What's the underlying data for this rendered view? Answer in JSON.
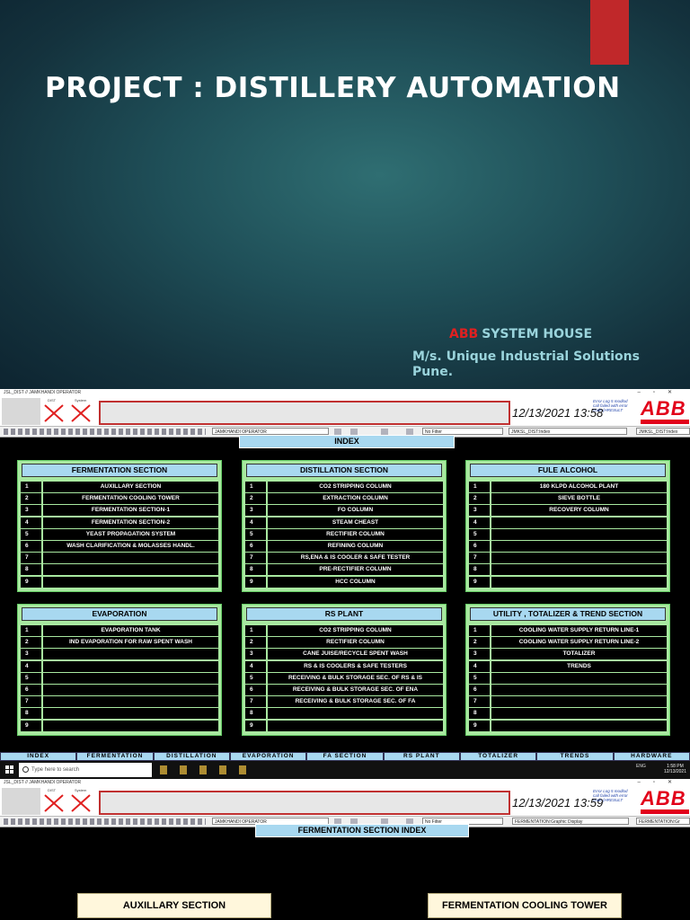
{
  "slide": {
    "title": "PROJECT : DISTILLERY AUTOMATION",
    "brand": "ABB",
    "brand_suffix": "SYSTEM HOUSE",
    "company_line1": "M/s. Unique Industrial Solutions",
    "company_line2": "Pune.",
    "accent_color": "#c0282a"
  },
  "screen1": {
    "window_title": "JSL_DIST // JAMKHANDI OPERATOR",
    "ack_labels": [
      "DIST",
      "System"
    ],
    "datetime": "12/13/2021 13:58",
    "error_log": "Error Log 5 modlod call failed with error code (HRESULT",
    "abb_logo": "ABB",
    "operator_combo": "JAMKHANDI OPERATOR",
    "filter_combo": "No Filter",
    "display_combo": "JMKSL_DIST:Index",
    "display_combo2": "JMKSL_DIST:Index",
    "index_title": "INDEX",
    "panels": [
      {
        "title": "FERMENTATION SECTION",
        "rows": [
          {
            "n": "1",
            "label": "AUXILLARY SECTION"
          },
          {
            "n": "2",
            "label": "FERMENTATION COOLING TOWER"
          },
          {
            "n": "3",
            "label": "FERMENTATION SECTION-1"
          },
          {
            "n": "4",
            "label": "FERMENTATION SECTION-2"
          },
          {
            "n": "5",
            "label": "YEAST PROPAGATION SYSTEM"
          },
          {
            "n": "6",
            "label": "WASH CLARIFICATION & MOLASSES HANDL."
          },
          {
            "n": "7",
            "label": ""
          },
          {
            "n": "8",
            "label": ""
          },
          {
            "n": "9",
            "label": ""
          }
        ]
      },
      {
        "title": "DISTILLATION SECTION",
        "rows": [
          {
            "n": "1",
            "label": "CO2 STRIPPING COLUMN"
          },
          {
            "n": "2",
            "label": "EXTRACTION COLUMN"
          },
          {
            "n": "3",
            "label": "FO COLUMN"
          },
          {
            "n": "4",
            "label": "STEAM CHEAST"
          },
          {
            "n": "5",
            "label": "RECTIFIER COLUMN"
          },
          {
            "n": "6",
            "label": "REFINING COLUMN"
          },
          {
            "n": "7",
            "label": "RS,ENA & IS COOLER & SAFE TESTER"
          },
          {
            "n": "8",
            "label": "PRE-RECTIFIER COLUMN"
          },
          {
            "n": "9",
            "label": "HCC COLUMN"
          }
        ]
      },
      {
        "title": "FULE ALCOHOL",
        "rows": [
          {
            "n": "1",
            "label": "180 KLPD ALCOHOL PLANT"
          },
          {
            "n": "2",
            "label": "SIEVE BOTTLE"
          },
          {
            "n": "3",
            "label": "RECOVERY COLUMN"
          },
          {
            "n": "4",
            "label": ""
          },
          {
            "n": "5",
            "label": ""
          },
          {
            "n": "6",
            "label": ""
          },
          {
            "n": "7",
            "label": ""
          },
          {
            "n": "8",
            "label": ""
          },
          {
            "n": "9",
            "label": ""
          }
        ]
      },
      {
        "title": "EVAPORATION",
        "rows": [
          {
            "n": "1",
            "label": "EVAPORATION TANK"
          },
          {
            "n": "2",
            "label": "IND EVAPORATION FOR RAW SPENT WASH"
          },
          {
            "n": "3",
            "label": ""
          },
          {
            "n": "4",
            "label": ""
          },
          {
            "n": "5",
            "label": ""
          },
          {
            "n": "6",
            "label": ""
          },
          {
            "n": "7",
            "label": ""
          },
          {
            "n": "8",
            "label": ""
          },
          {
            "n": "9",
            "label": ""
          }
        ]
      },
      {
        "title": "RS PLANT",
        "rows": [
          {
            "n": "1",
            "label": "CO2 STRIPPING COLUMN"
          },
          {
            "n": "2",
            "label": "RECTIFIER COLUMN"
          },
          {
            "n": "3",
            "label": "CANE JUISE/RECYCLE SPENT WASH"
          },
          {
            "n": "4",
            "label": "RS & IS COOLERS & SAFE TESTERS"
          },
          {
            "n": "5",
            "label": "RECEIVING & BULK STORAGE SEC. OF RS & IS"
          },
          {
            "n": "6",
            "label": "RECEIVING & BULK STORAGE SEC. OF ENA"
          },
          {
            "n": "7",
            "label": "RECEIVING & BULK STORAGE SEC. OF FA"
          },
          {
            "n": "8",
            "label": ""
          },
          {
            "n": "9",
            "label": ""
          }
        ]
      },
      {
        "title": "UTILITY , TOTALIZER & TREND SECTION",
        "rows": [
          {
            "n": "1",
            "label": "COOLING WATER SUPPLY RETURN LINE-1"
          },
          {
            "n": "2",
            "label": "COOLING WATER SUPPLY RETURN LINE-2"
          },
          {
            "n": "3",
            "label": "TOTALIZER"
          },
          {
            "n": "4",
            "label": "TRENDS"
          },
          {
            "n": "5",
            "label": ""
          },
          {
            "n": "6",
            "label": ""
          },
          {
            "n": "7",
            "label": ""
          },
          {
            "n": "8",
            "label": ""
          },
          {
            "n": "9",
            "label": ""
          }
        ]
      }
    ],
    "nav": [
      "INDEX",
      "FERMENTATION",
      "DISTILLATION",
      "EVAPORATION",
      "FA SECTION",
      "RS PLANT",
      "TOTALIZER",
      "TRENDS",
      "HARDWARE"
    ]
  },
  "taskbar": {
    "search_placeholder": "Type here to search",
    "lang": "ENG",
    "time": "1:58 PM",
    "date": "12/13/2021"
  },
  "screen2": {
    "window_title": "JSL_DIST // JAMKHANDI OPERATOR",
    "ack_labels": [
      "DIST",
      "System"
    ],
    "datetime": "12/13/2021 13:59",
    "error_log": "Error Log 5 modlod call failed with error code (HRESULT",
    "abb_logo": "ABB",
    "operator_combo": "JAMKHANDI OPERATOR",
    "filter_combo": "No Filter",
    "display_combo": "FERMENTATION:Graphic Display",
    "display_combo2": "FERMENTATION:Gr",
    "index_title": "FERMENTATION SECTION INDEX",
    "buttons": [
      "AUXILLARY SECTION",
      "FERMENTATION COOLING TOWER"
    ]
  }
}
